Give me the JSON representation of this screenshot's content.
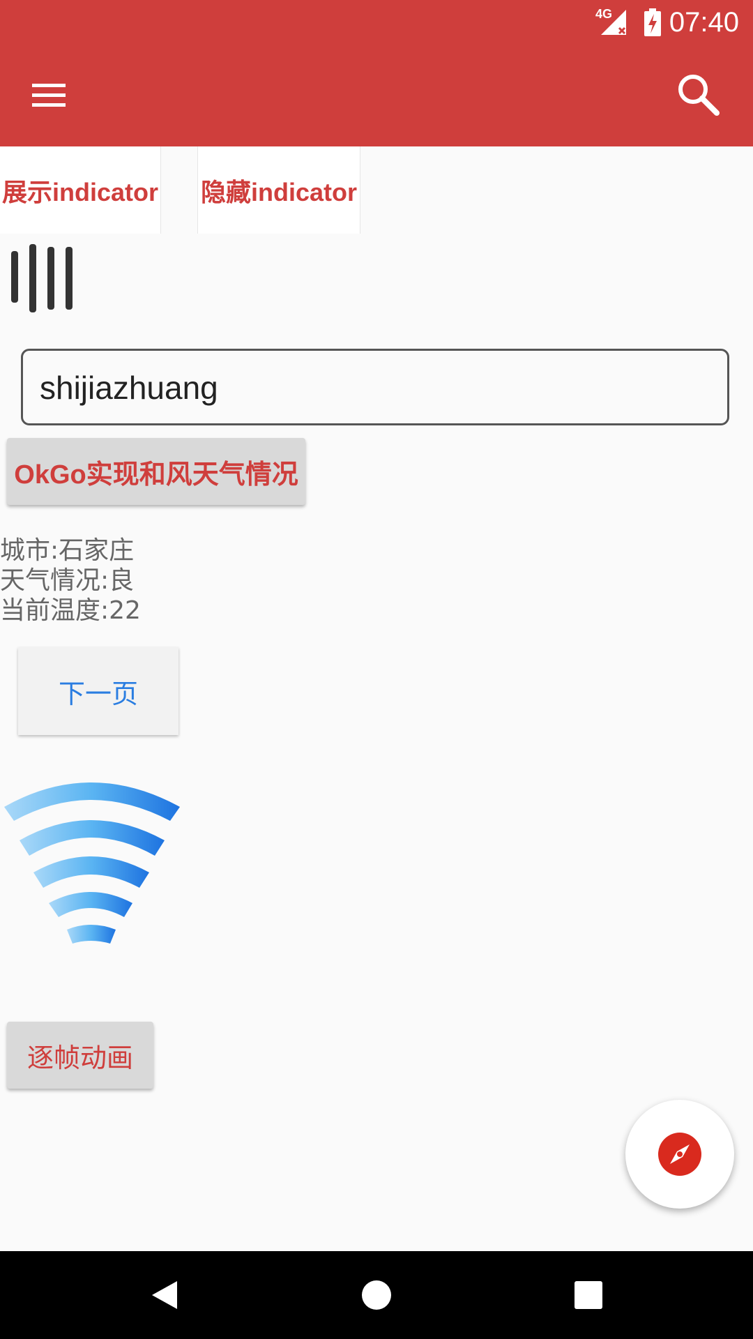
{
  "status_bar": {
    "time": "07:40",
    "network": "4G"
  },
  "tabs": [
    {
      "label": "展示indicator"
    },
    {
      "label": "隐藏indicator"
    }
  ],
  "city_input": {
    "value": "shijiazhuang"
  },
  "okgo_button": {
    "label": "OkGo实现和风天气情况"
  },
  "weather": {
    "city": "城市:石家庄",
    "condition": "天气情况:良",
    "temperature": "当前温度:22"
  },
  "next_page_button": {
    "label": "下一页"
  },
  "frame_animation_button": {
    "label": "逐帧动画"
  },
  "icons": {
    "menu": "menu-icon",
    "search": "search-icon",
    "loader": "loading-bars-icon",
    "wifi": "wifi-signal-icon",
    "fab": "compass-icon",
    "back": "back-icon",
    "home": "home-icon",
    "recents": "recents-icon"
  },
  "colors": {
    "app_bar": "#cf3e3c",
    "accent_text": "#cf3e3c",
    "link_blue": "#2a7de1",
    "background": "#fafafa"
  }
}
